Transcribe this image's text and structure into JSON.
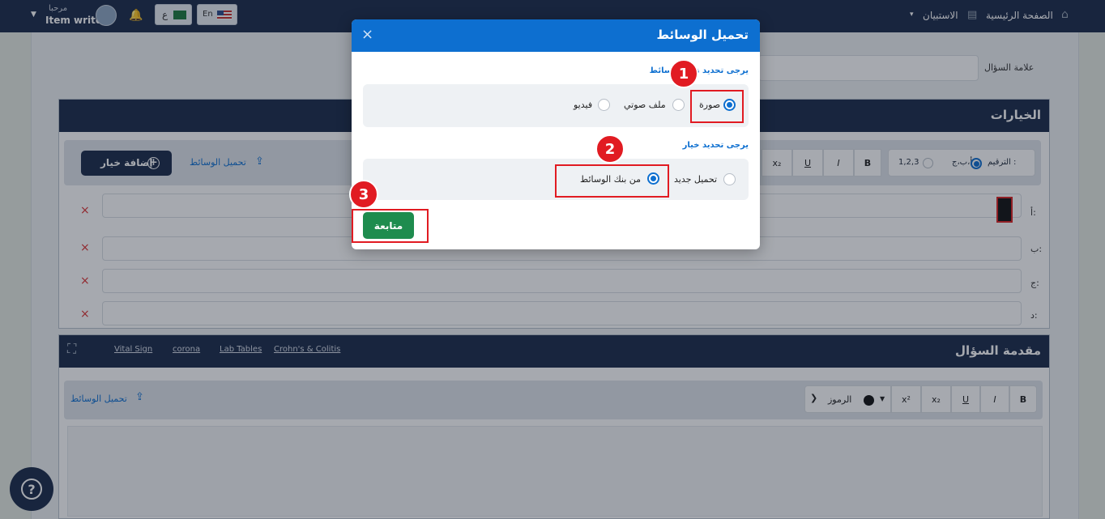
{
  "topbar": {
    "user_greeting": "مرحبا",
    "user_name": "Item writer",
    "lang_ar": "ع",
    "lang_en": "En",
    "nav_home": "الصفحة الرئيسية",
    "nav_survey": "الاستبيان"
  },
  "question_mark_label": "علامة السؤال",
  "choices": {
    "title": "الخيارات",
    "add_choice": "إضافة خيار",
    "upload_media": "تحميل الوسائط",
    "numbering_label": "الترقيم :",
    "numbering_opt1": "أ،ب،ج",
    "numbering_opt2": "1,2,3",
    "format_buttons": [
      "B",
      "I",
      "U",
      "x₂"
    ],
    "rows": [
      {
        "label": "أ:"
      },
      {
        "label": "ب:"
      },
      {
        "label": "ج:"
      },
      {
        "label": "د:"
      }
    ],
    "remove": "×"
  },
  "intro": {
    "title": "مقدمة السؤال",
    "links": [
      "Vital Sign",
      "corona",
      "Lab Tables",
      "Crohn's & Colitis"
    ],
    "upload_media": "تحميل الوسائط",
    "symbols": "الرموز",
    "format_buttons": [
      "B",
      "I",
      "U",
      "x₂",
      "x²"
    ]
  },
  "modal": {
    "title": "تحميل الوسائط",
    "close": "×",
    "type_prompt": "يرجى تحديد نوع الوسائط",
    "type_options": {
      "image": "صورة",
      "audio": "ملف صوتي",
      "video": "فيديو"
    },
    "type_selected": "image",
    "source_prompt": "يرجى تحديد خيار",
    "source_options": {
      "new": "تحميل جديد",
      "bank": "من بنك الوسائط"
    },
    "source_selected": "bank",
    "continue": "متابعة"
  },
  "callouts": [
    "1",
    "2",
    "3"
  ],
  "colors": {
    "navy": "#1b2a49",
    "modal_header": "#0d6fd0",
    "continue": "#1e8c4e",
    "highlight": "#e11b22"
  }
}
